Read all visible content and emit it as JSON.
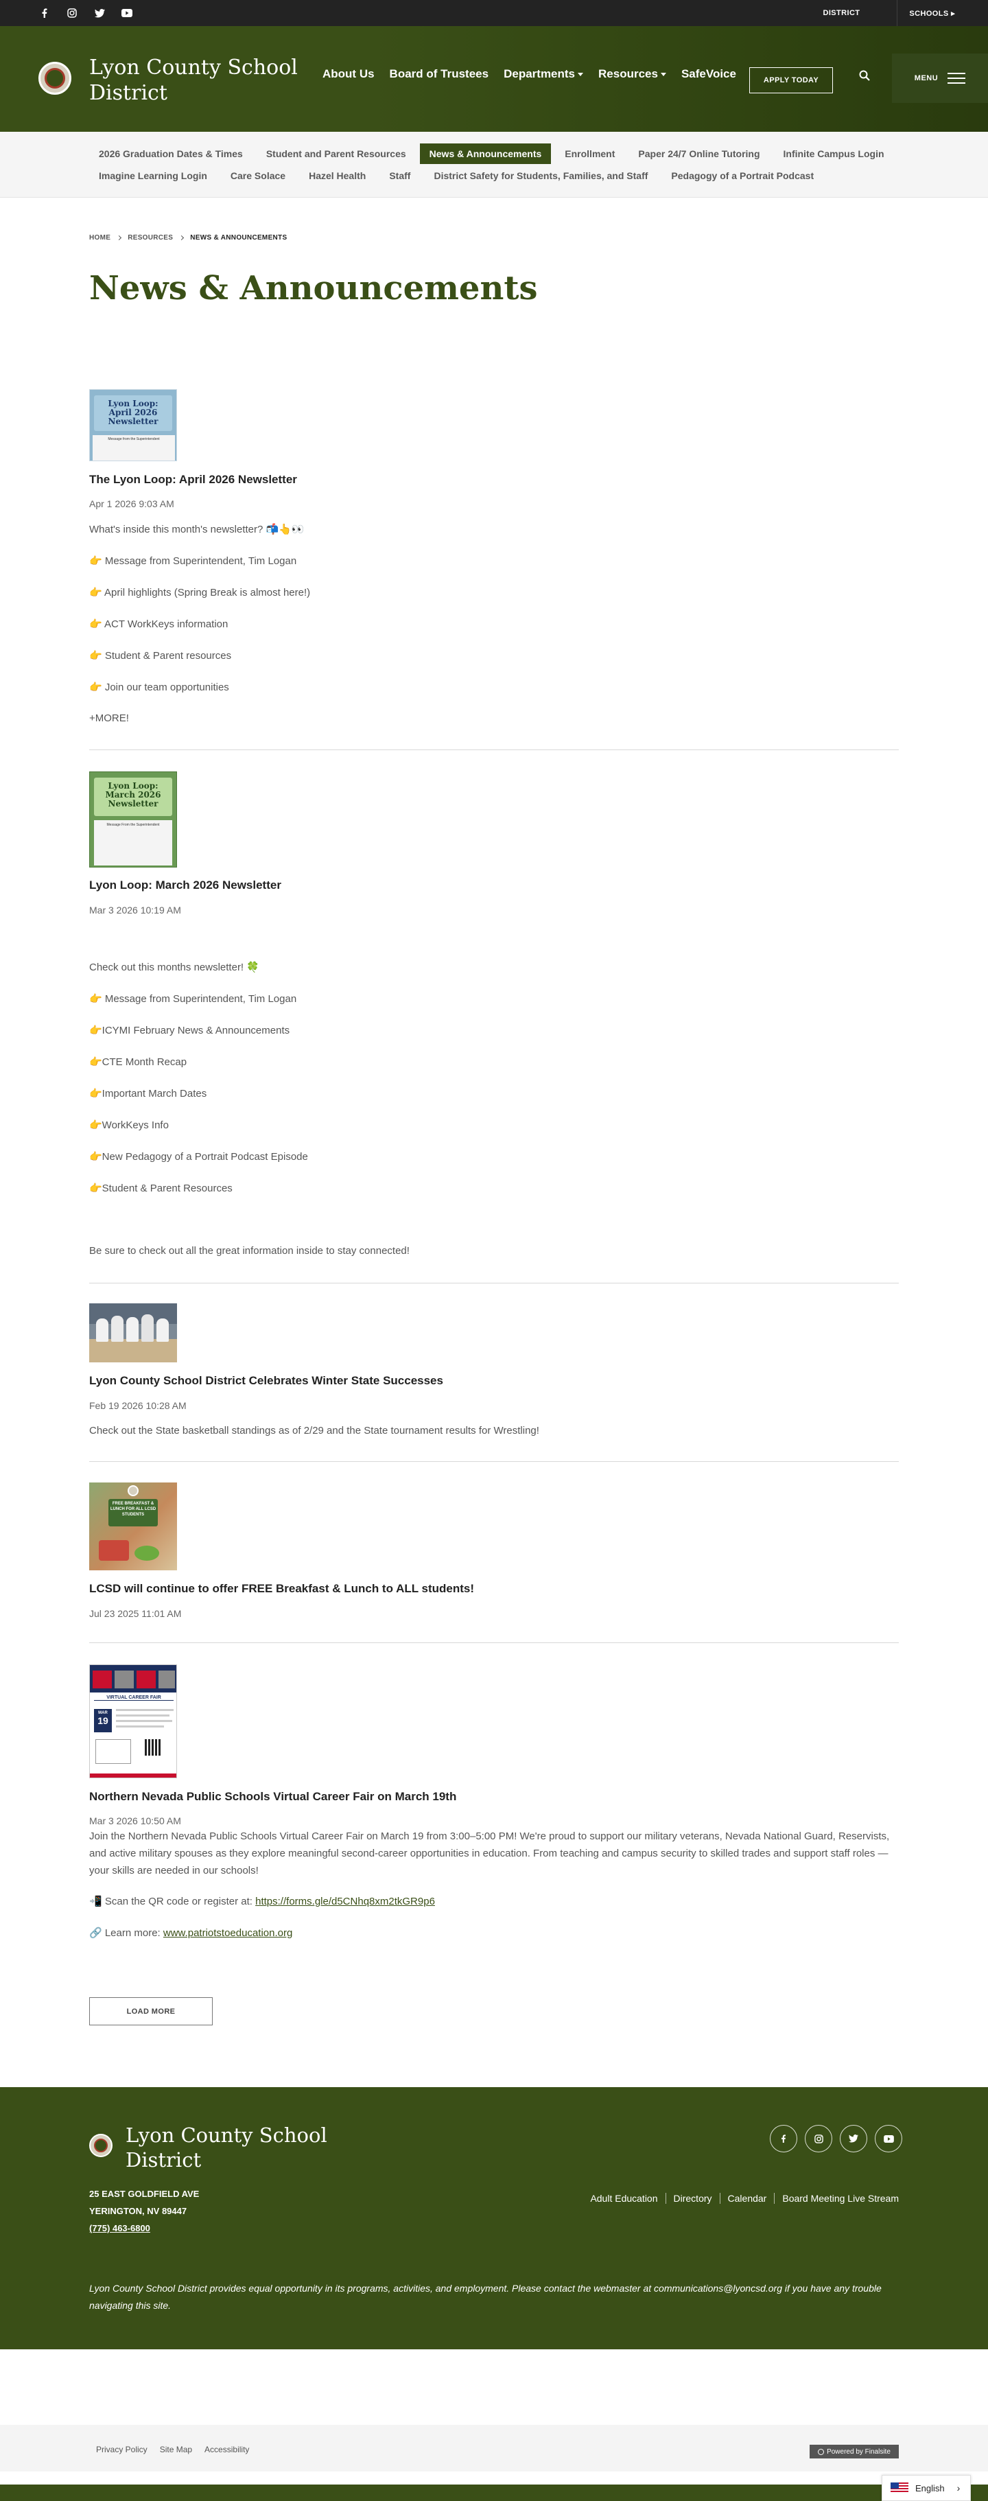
{
  "utility_bar": {
    "social_icons": [
      "facebook-icon",
      "instagram-icon",
      "twitter-icon",
      "youtube-icon"
    ],
    "district_label": "DISTRICT",
    "schools_label": "SCHOOLS"
  },
  "header": {
    "site_title": "Lyon County School District",
    "nav": [
      "About Us",
      "Board of Trustees",
      "Departments",
      "Resources",
      "SafeVoice"
    ],
    "apply_label": "APPLY TODAY",
    "menu_label": "MENU"
  },
  "subnav": {
    "row1": [
      "2026 Graduation Dates & Times",
      "Student and Parent Resources",
      "News & Announcements",
      "Enrollment",
      "Paper 24/7 Online Tutoring",
      "Infinite Campus Login"
    ],
    "row2": [
      "Imagine Learning Login",
      "Care Solace",
      "Hazel Health",
      "Staff",
      "District Safety for Students, Families, and Staff",
      "Pedagogy of a Portrait Podcast"
    ]
  },
  "breadcrumb": {
    "home": "HOME",
    "resources": "RESOURCES",
    "current": "NEWS & ANNOUNCEMENTS"
  },
  "page_title": "News & Announcements",
  "articles": [
    {
      "thumb_title": "Lyon Loop: April 2026 Newsletter",
      "thumb_caption": "Message from the Superintendent",
      "title": "The Lyon Loop: April 2026 Newsletter",
      "date": "Apr 1 2026 9:03 AM",
      "lines": [
        "What's inside this month's newsletter? 📬👆👀",
        "👉 Message from Superintendent, Tim Logan",
        "👉 April highlights (Spring Break is almost here!)",
        "👉 ACT WorkKeys information",
        "👉 Student & Parent resources",
        "👉 Join our team opportunities",
        "+MORE!"
      ]
    },
    {
      "thumb_title": "Lyon Loop: March 2026 Newsletter",
      "thumb_caption": "Message From the Superintendent",
      "title": "Lyon Loop: March 2026 Newsletter",
      "date": "Mar 3 2026 10:19 AM",
      "lines": [
        "Check out this months newsletter! 🍀",
        "👉 Message from Superintendent, Tim Logan",
        "👉ICYMI February News & Announcements",
        "👉CTE Month Recap",
        "👉Important March Dates",
        "👉WorkKeys Info",
        "👉New Pedagogy of a Portrait Podcast Episode",
        "👉Student & Parent Resources",
        "Be sure to check out all the great information inside to stay connected!"
      ]
    },
    {
      "title": "Lyon County School District Celebrates Winter State Successes",
      "date": "Feb 19 2026 10:28 AM",
      "summary": "Check out the State basketball standings as of 2/29 and the State tournament results for Wrestling!"
    },
    {
      "thumb_title": "FREE BREAKFAST & LUNCH FOR ALL LCSD STUDENTS",
      "title": "LCSD will continue to offer FREE Breakfast & Lunch to ALL students!",
      "date": "Jul 23 2025 11:01 AM"
    },
    {
      "thumb_title": "VIRTUAL CAREER FAIR",
      "thumb_month": "MAR",
      "thumb_day": "19",
      "title": "Northern Nevada Public Schools Virtual Career Fair on March 19th",
      "date": "Mar 3 2026 10:50 AM",
      "paragraph": "Join the Northern Nevada Public Schools Virtual Career Fair on March 19 from 3:00–5:00 PM! We're proud to support our military veterans, Nevada National Guard, Reservists, and active military spouses as they explore meaningful second-career opportunities in education. From teaching and campus security to skilled trades and support staff roles — your skills are needed in our schools!",
      "qr_prefix": "📲 Scan the QR code or register at: ",
      "qr_link": "https://forms.gle/d5CNhq8xm2tkGR9p6",
      "learn_prefix": "🔗 Learn more: ",
      "learn_link": "www.patriotstoeducation.org"
    }
  ],
  "load_more_label": "LOAD MORE",
  "footer": {
    "title": "Lyon County School District",
    "address1": "25 EAST GOLDFIELD AVE",
    "address2": "YERINGTON, NV  89447",
    "phone": "(775) 463-6800",
    "links": [
      "Adult Education",
      "Directory",
      "Calendar",
      "Board Meeting Live Stream"
    ],
    "eo_statement": "Lyon County School District  provides equal opportunity in its programs, activities, and employment. Please contact the webmaster at communications@lyoncsd.org if you have any trouble navigating this site."
  },
  "bottom_bar": {
    "links": [
      "Privacy Policy",
      "Site Map",
      "Accessibility"
    ],
    "powered_by": "Powered by Finalsite"
  },
  "language": "English",
  "colors": {
    "brand_green": "#3a4f17",
    "utility_dark": "#232323",
    "accent_red": "#a43b2a"
  }
}
